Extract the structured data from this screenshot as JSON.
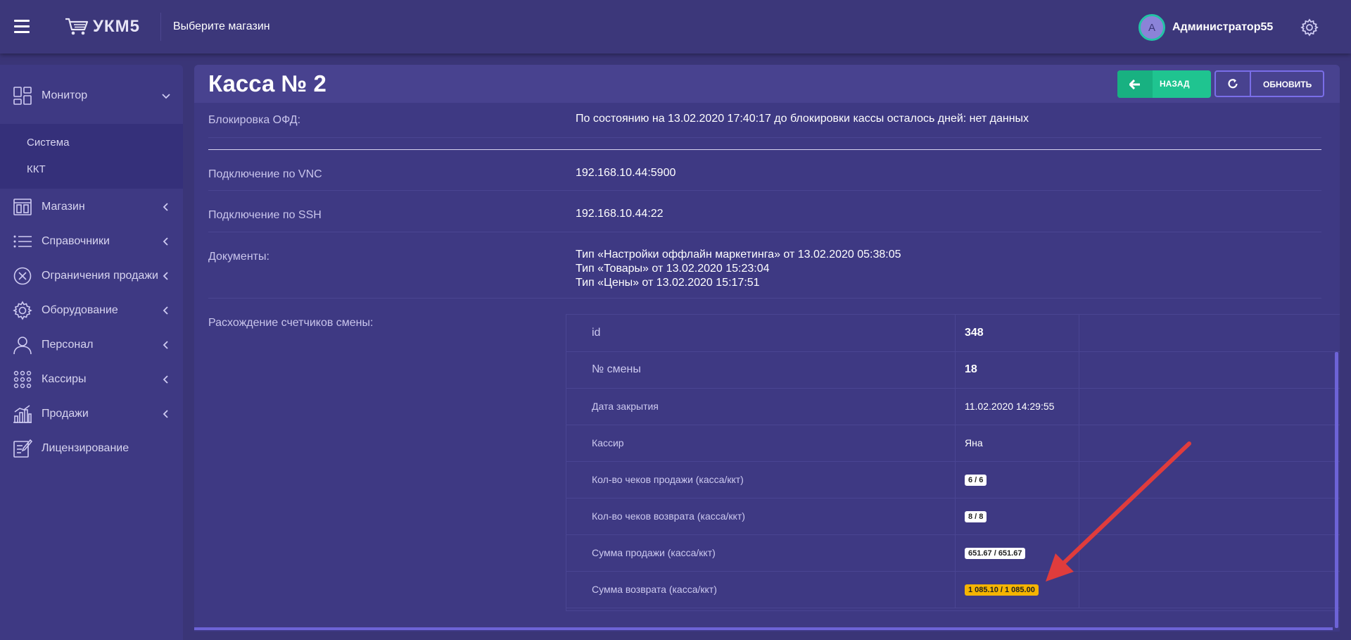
{
  "header": {
    "logo_text": "УКМ5",
    "store_select": "Выберите магазин",
    "avatar_letter": "A",
    "user_name": "Администратор55"
  },
  "sidebar": {
    "items": [
      {
        "label": "Монитор",
        "icon": "grid-icon",
        "expanded": true
      },
      {
        "label": "Магазин",
        "icon": "store-icon"
      },
      {
        "label": "Справочники",
        "icon": "list-icon"
      },
      {
        "label": "Ограничения продажи",
        "icon": "cancel-circle-icon"
      },
      {
        "label": "Оборудование",
        "icon": "gear-icon"
      },
      {
        "label": "Персонал",
        "icon": "person-icon"
      },
      {
        "label": "Кассиры",
        "icon": "dots-grid-icon"
      },
      {
        "label": "Продажи",
        "icon": "bar-chart-icon"
      },
      {
        "label": "Лицензирование",
        "icon": "edit-document-icon"
      }
    ],
    "submenu": [
      "Система",
      "ККТ"
    ]
  },
  "page": {
    "title": "Касса № 2",
    "back_label": "НАЗАД",
    "refresh_label": "ОБНОВИТЬ",
    "rows": [
      {
        "label": "Блокировка ОФД:",
        "value": "По состоянию на 13.02.2020 17:40:17 до блокировки кассы осталось дней: нет данных"
      },
      {
        "label": "Подключение по VNC",
        "value": "192.168.10.44:5900"
      },
      {
        "label": "Подключение по SSH",
        "value": "192.168.10.44:22"
      },
      {
        "label": "Документы:",
        "values": [
          "Тип «Настройки оффлайн маркетинга» от 13.02.2020 05:38:05",
          "Тип «Товары» от 13.02.2020 15:23:04",
          "Тип «Цены» от 13.02.2020 15:17:51"
        ]
      },
      {
        "label": "Расхождение счетчиков смены:"
      }
    ],
    "shift_table": [
      {
        "label": "id",
        "value": "348"
      },
      {
        "label": "№ смены",
        "value": "18"
      },
      {
        "label": "Дата закрытия",
        "value": "11.02.2020 14:29:55"
      },
      {
        "label": "Кассир",
        "value": "Яна"
      },
      {
        "label": "Кол-во чеков продажи (касса/ккт)",
        "value": "6 / 6"
      },
      {
        "label": "Кол-во чеков возврата (касса/ккт)",
        "value": "8 / 8"
      },
      {
        "label": "Сумма продажи (касса/ккт)",
        "value": "651.67 / 651.67"
      },
      {
        "label": "Сумма возврата (касса/ккт)",
        "value": "1 085.10 / 1 085.00",
        "status": "mismatch"
      }
    ]
  },
  "colors": {
    "background": "#3a3577",
    "panel": "#3e3983",
    "accent_green": "#1fc490",
    "accent_purple": "#7a6ee8",
    "warning_badge": "#f5b400",
    "annotation_arrow": "#e03c3c"
  }
}
